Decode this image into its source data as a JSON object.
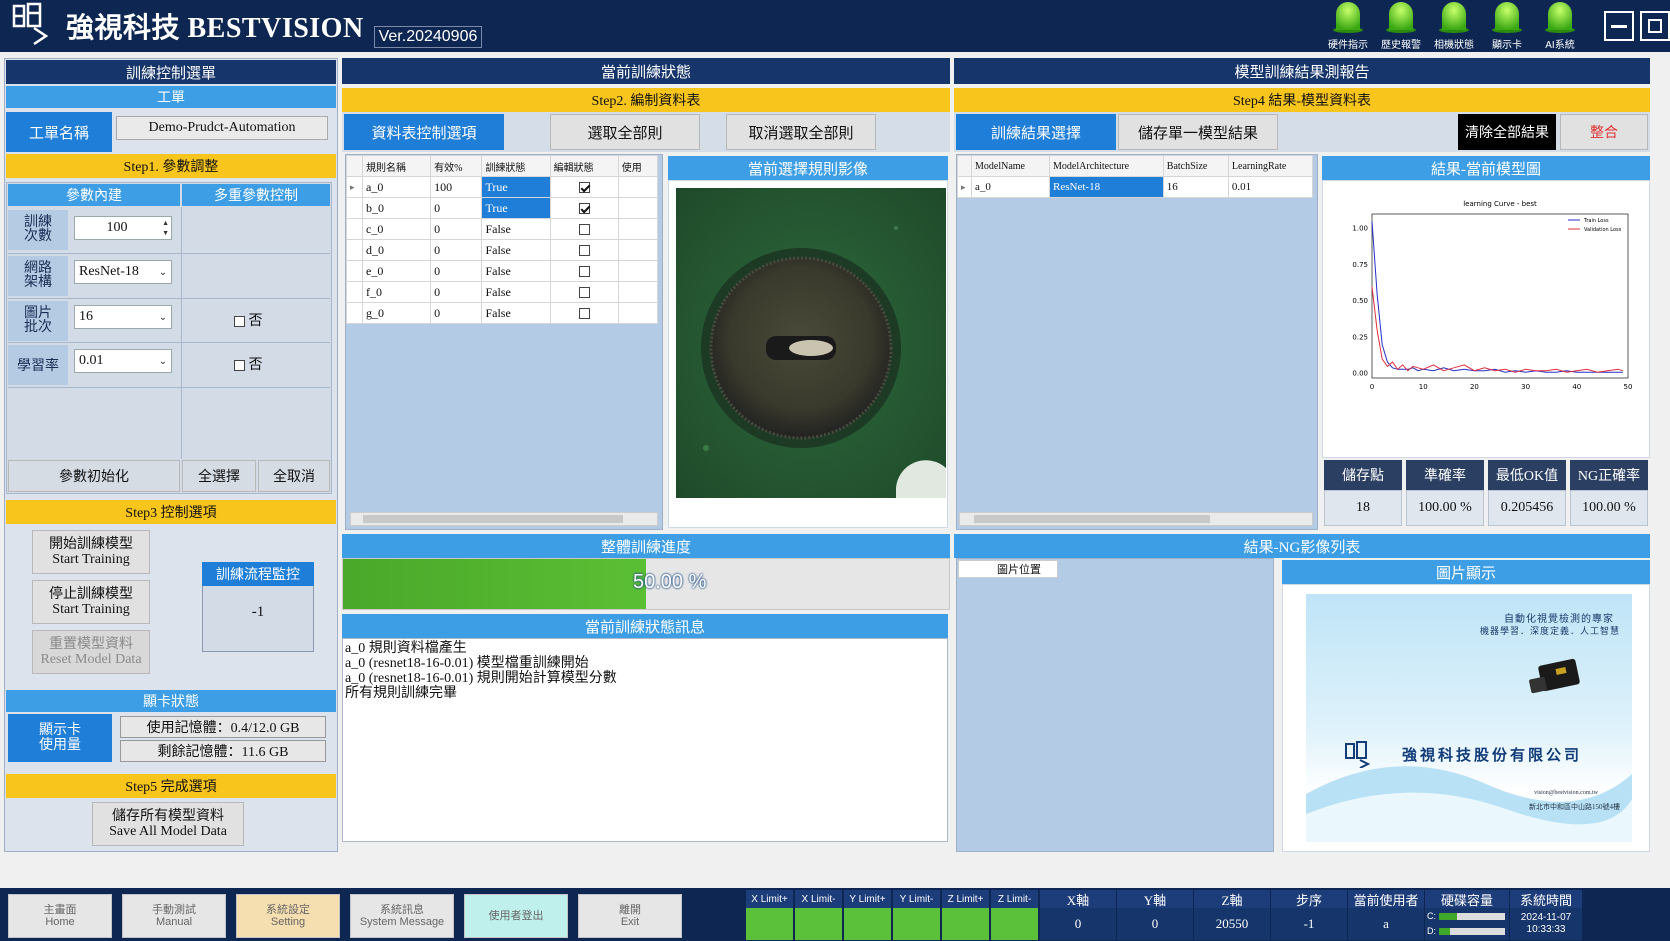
{
  "header": {
    "brand": "強視科技 BESTVISION",
    "version": "Ver.20240906",
    "lamps": [
      "硬件指示",
      "歷史報警",
      "相機狀態",
      "顯示卡",
      "AI系統"
    ]
  },
  "left": {
    "title": "訓練控制選單",
    "work_header": "工單",
    "work_name_label": "工單名稱",
    "work_name_value": "Demo-Prudct-Automation",
    "step1": "Step1. 參數調整",
    "param_builtin": "參數內建",
    "multi_param": "多重參數控制",
    "epochs_label": "訓練\n次數",
    "epochs_value": "100",
    "net_label": "網路\n架構",
    "net_value": "ResNet-18",
    "batch_label": "圖片\n批次",
    "batch_value": "16",
    "batch_multi": "否",
    "lr_label": "學習率",
    "lr_value": "0.01",
    "lr_multi": "否",
    "param_init": "參數初始化",
    "select_all": "全選擇",
    "cancel_all": "全取消",
    "step3": "Step3 控制選項",
    "start_zh": "開始訓練模型",
    "start_en": "Start Training",
    "stop_zh": "停止訓練模型",
    "stop_en": "Start Training",
    "reset_zh": "重置模型資料",
    "reset_en": "Reset Model Data",
    "monitor_title": "訓練流程監控",
    "monitor_value": "-1",
    "gpu_title": "顯卡狀態",
    "gpu_label": "顯示卡\n使用量",
    "gpu_used": "使用記憶體：0.4/12.0 GB",
    "gpu_free": "剩餘記憶體：11.6 GB",
    "step5": "Step5 完成選項",
    "save_zh": "儲存所有模型資料",
    "save_en": "Save All Model Data"
  },
  "mid": {
    "title": "當前訓練狀態",
    "step2": "Step2. 編制資料表",
    "tab_control": "資料表控制選項",
    "btn_select_all": "選取全部則",
    "btn_deselect_all": "取消選取全部則",
    "table_headers": [
      "規則名稱",
      "有效%",
      "訓練狀態",
      "編輯狀態",
      "使用"
    ],
    "rows": [
      {
        "name": "a_0",
        "valid": "100",
        "train": "True",
        "edit": true
      },
      {
        "name": "b_0",
        "valid": "0",
        "train": "True",
        "edit": true
      },
      {
        "name": "c_0",
        "valid": "0",
        "train": "False",
        "edit": false
      },
      {
        "name": "d_0",
        "valid": "0",
        "train": "False",
        "edit": false
      },
      {
        "name": "e_0",
        "valid": "0",
        "train": "False",
        "edit": false
      },
      {
        "name": "f_0",
        "valid": "0",
        "train": "False",
        "edit": false
      },
      {
        "name": "g_0",
        "valid": "0",
        "train": "False",
        "edit": false
      }
    ],
    "image_title": "當前選擇規則影像",
    "progress_title": "整體訓練進度",
    "progress_value": 0.5,
    "progress_text": "50.00 %",
    "log_title": "當前訓練狀態訊息",
    "log_lines": [
      "a_0 規則資料檔產生",
      "a_0 (resnet18-16-0.01) 模型檔重訓練開始",
      "a_0 (resnet18-16-0.01) 規則開始計算模型分數",
      "所有規則訓練完畢"
    ]
  },
  "right": {
    "title": "模型訓練結果測報告",
    "step4": "Step4 結果-模型資料表",
    "tab_result": "訓練結果選擇",
    "btn_save_single": "儲存單一模型結果",
    "btn_clear_all": "清除全部結果",
    "btn_merge": "整合",
    "table_headers": [
      "ModelName",
      "ModelArchitecture",
      "BatchSize",
      "LearningRate"
    ],
    "table_row": [
      "a_0",
      "ResNet-18",
      "16",
      "0.01"
    ],
    "chart_title_bar": "結果-當前模型圖",
    "stats_headers": [
      "儲存點",
      "準確率",
      "最低OK值",
      "NG正確率"
    ],
    "stats_values": [
      "18",
      "100.00 %",
      "0.205456",
      "100.00 %"
    ],
    "ng_title": "結果-NG影像列表",
    "ng_col": "圖片位置",
    "img_title": "圖片顯示",
    "brochure_line1": "自動化視覺檢測的專家",
    "brochure_line2": "機器學習．深度定義．人工智慧",
    "company": "強視科技股份有限公司",
    "contact_email": "vision@bestvision.com.tw",
    "contact_addr": "新北市中和區中山路150號4樓"
  },
  "chart_data": {
    "type": "line",
    "title": "learning Curve - best",
    "xlabel": "",
    "ylabel": "",
    "xlim": [
      0,
      50
    ],
    "ylim": [
      -0.03,
      1.1
    ],
    "xticks": [
      0,
      10,
      20,
      30,
      40,
      50
    ],
    "yticks": [
      "0.00",
      "0.25",
      "0.50",
      "0.75",
      "1.00"
    ],
    "legend": "top-right",
    "series": [
      {
        "name": "Train Loss",
        "color": "#2430c8",
        "x": [
          0,
          1,
          2,
          3,
          4,
          5,
          6,
          7,
          8,
          9,
          10,
          12,
          14,
          16,
          18,
          20,
          22,
          24,
          26,
          28,
          30,
          32,
          34,
          36,
          38,
          40,
          42,
          44,
          46,
          48,
          49
        ],
        "y": [
          1.05,
          0.55,
          0.2,
          0.08,
          0.04,
          0.03,
          0.03,
          0.03,
          0.04,
          0.02,
          0.03,
          0.02,
          0.04,
          0.02,
          0.03,
          0.02,
          0.02,
          0.03,
          0.01,
          0.02,
          0.01,
          0.02,
          0.01,
          0.01,
          0.02,
          0.01,
          0.01,
          0.01,
          0.01,
          0.01,
          0.01
        ]
      },
      {
        "name": "Validation Loss",
        "color": "#e0303a",
        "x": [
          0,
          1,
          2,
          3,
          4,
          5,
          6,
          7,
          8,
          9,
          10,
          12,
          14,
          16,
          18,
          20,
          22,
          24,
          26,
          28,
          30,
          32,
          34,
          36,
          38,
          40,
          42,
          44,
          46,
          48,
          49
        ],
        "y": [
          0.6,
          0.3,
          0.1,
          0.05,
          0.08,
          0.03,
          0.06,
          0.02,
          0.05,
          0.04,
          0.03,
          0.06,
          0.02,
          0.04,
          0.06,
          0.02,
          0.04,
          0.02,
          0.03,
          0.01,
          0.03,
          0.02,
          0.02,
          0.03,
          0.01,
          0.02,
          0.03,
          0.01,
          0.02,
          0.03,
          0.02
        ]
      }
    ]
  },
  "footer": {
    "buttons": [
      {
        "zh": "主畫面",
        "en": "Home"
      },
      {
        "zh": "手動測試",
        "en": "Manual"
      },
      {
        "zh": "系統設定",
        "en": "Setting"
      },
      {
        "zh": "系統訊息",
        "en": "System Message"
      },
      {
        "zh": "使用者登出",
        "en": ""
      },
      {
        "zh": "離開",
        "en": "Exit"
      }
    ],
    "limits": [
      "X Limit+",
      "X Limit-",
      "Y Limit+",
      "Y Limit-",
      "Z Limit+",
      "Z Limit-"
    ],
    "axes_headers": [
      "X軸",
      "Y軸",
      "Z軸",
      "步序",
      "當前使用者",
      "硬碟容量",
      "系統時間"
    ],
    "axes_values": [
      "0",
      "0",
      "20550",
      "-1",
      "a"
    ],
    "disk_c": "C:",
    "disk_d": "D:",
    "disk_c_used": 0.28,
    "disk_d_used": 0.16,
    "date": "2024-11-07",
    "time": "10:33:33"
  }
}
